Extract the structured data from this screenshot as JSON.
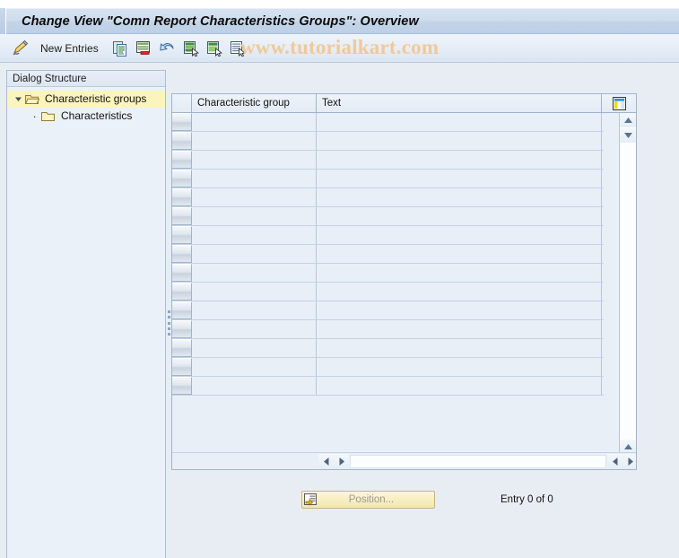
{
  "window": {
    "title": "Change View \"Comn Report Characteristics Groups\": Overview"
  },
  "watermark": {
    "text": "www.tutorialkart.com",
    "color": "#f0c99a"
  },
  "toolbar": {
    "display_change_icon": "pencil-display-change-icon",
    "new_entries_label": "New Entries",
    "buttons": [
      {
        "name": "copy-as-icon",
        "tooltip": "Copy As..."
      },
      {
        "name": "delete-icon",
        "tooltip": "Delete"
      },
      {
        "name": "undo-icon",
        "tooltip": "Undo Change"
      },
      {
        "name": "select-all-icon",
        "tooltip": "Select All"
      },
      {
        "name": "select-block-icon",
        "tooltip": "Select Block"
      },
      {
        "name": "deselect-all-icon",
        "tooltip": "Deselect All"
      }
    ]
  },
  "sidebar": {
    "header": "Dialog Structure",
    "items": [
      {
        "label": "Characteristic groups",
        "level": 0,
        "expanded": true,
        "selected": true,
        "icon": "folder-open-icon",
        "twisty": "triangle-down-icon"
      },
      {
        "label": "Characteristics",
        "level": 1,
        "expanded": false,
        "selected": false,
        "icon": "folder-closed-icon",
        "twisty": "bullet-dot-icon"
      }
    ]
  },
  "table": {
    "columns": [
      {
        "key": "characteristic_group",
        "label": "Characteristic group"
      },
      {
        "key": "text",
        "label": "Text"
      }
    ],
    "settings_icon": "table-settings-icon",
    "rows": [],
    "empty_row_count": 15,
    "vertical_scrollbar": {
      "up_arrow": "scroll-up-icon",
      "down_arrow": "scroll-down-icon",
      "page_up_arrow": "scroll-page-up-icon",
      "page_down_arrow": "scroll-page-down-icon"
    },
    "horizontal_scrollbar": {
      "left_arrow": "scroll-left-icon",
      "right_arrow": "scroll-right-icon"
    }
  },
  "footer": {
    "position_button": {
      "label": "Position...",
      "icon": "position-icon",
      "enabled": false
    },
    "entry_status": "Entry 0 of 0"
  },
  "colors": {
    "title_bar": "#c6d6ea",
    "toolbar": "#e4ecf6",
    "tree_selection": "#fbf5bd",
    "pane_background": "#eaf1f9",
    "body_background": "#e8edf4",
    "grid_cell": "#e9eff7",
    "button_yellow": "#f8eec2"
  }
}
